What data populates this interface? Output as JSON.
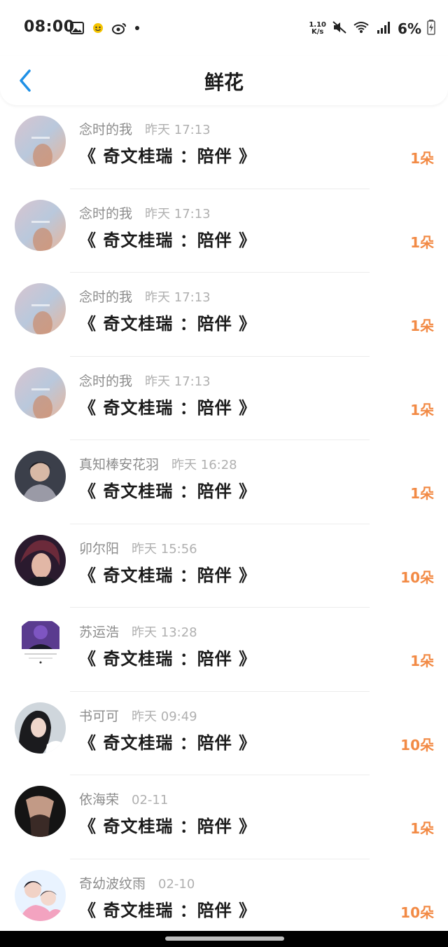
{
  "status": {
    "time": "08:00",
    "net_speed_value": "1.10",
    "net_speed_unit": "K/s",
    "battery": "6%",
    "icons": [
      "image-icon",
      "smiley-icon",
      "weibo-icon",
      "dot-icon",
      "mute-icon",
      "wifi-icon",
      "signal-icon",
      "battery-charging-icon"
    ]
  },
  "nav": {
    "back_icon": "chevron-left-icon",
    "title": "鲜花"
  },
  "colors": {
    "accent": "#1e90e6",
    "count": "#f28a45",
    "username": "#8c8c8c",
    "time": "#b0b0b0"
  },
  "rows": [
    {
      "user": "念时的我",
      "time": "昨天 17:13",
      "work": "《 奇文桂瑞 ：陪伴 》",
      "count": "1朵"
    },
    {
      "user": "念时的我",
      "time": "昨天 17:13",
      "work": "《 奇文桂瑞 ：陪伴 》",
      "count": "1朵"
    },
    {
      "user": "念时的我",
      "time": "昨天 17:13",
      "work": "《 奇文桂瑞 ：陪伴 》",
      "count": "1朵"
    },
    {
      "user": "念时的我",
      "time": "昨天 17:13",
      "work": "《 奇文桂瑞 ：陪伴 》",
      "count": "1朵"
    },
    {
      "user": "真知棒安花羽",
      "time": "昨天 16:28",
      "work": "《 奇文桂瑞 ：陪伴 》",
      "count": "1朵"
    },
    {
      "user": "卯尔阳",
      "time": "昨天 15:56",
      "work": "《 奇文桂瑞 ：陪伴 》",
      "count": "10朵"
    },
    {
      "user": "苏运浩",
      "time": "昨天 13:28",
      "work": "《 奇文桂瑞 ：陪伴 》",
      "count": "1朵"
    },
    {
      "user": "书可可",
      "time": "昨天 09:49",
      "work": "《 奇文桂瑞 ：陪伴 》",
      "count": "10朵"
    },
    {
      "user": "依海荣",
      "time": "02-11",
      "work": "《 奇文桂瑞 ：陪伴 》",
      "count": "1朵"
    },
    {
      "user": "奇幼波纹雨",
      "time": "02-10",
      "work": "《 奇文桂瑞 ：陪伴 》",
      "count": "10朵"
    }
  ]
}
